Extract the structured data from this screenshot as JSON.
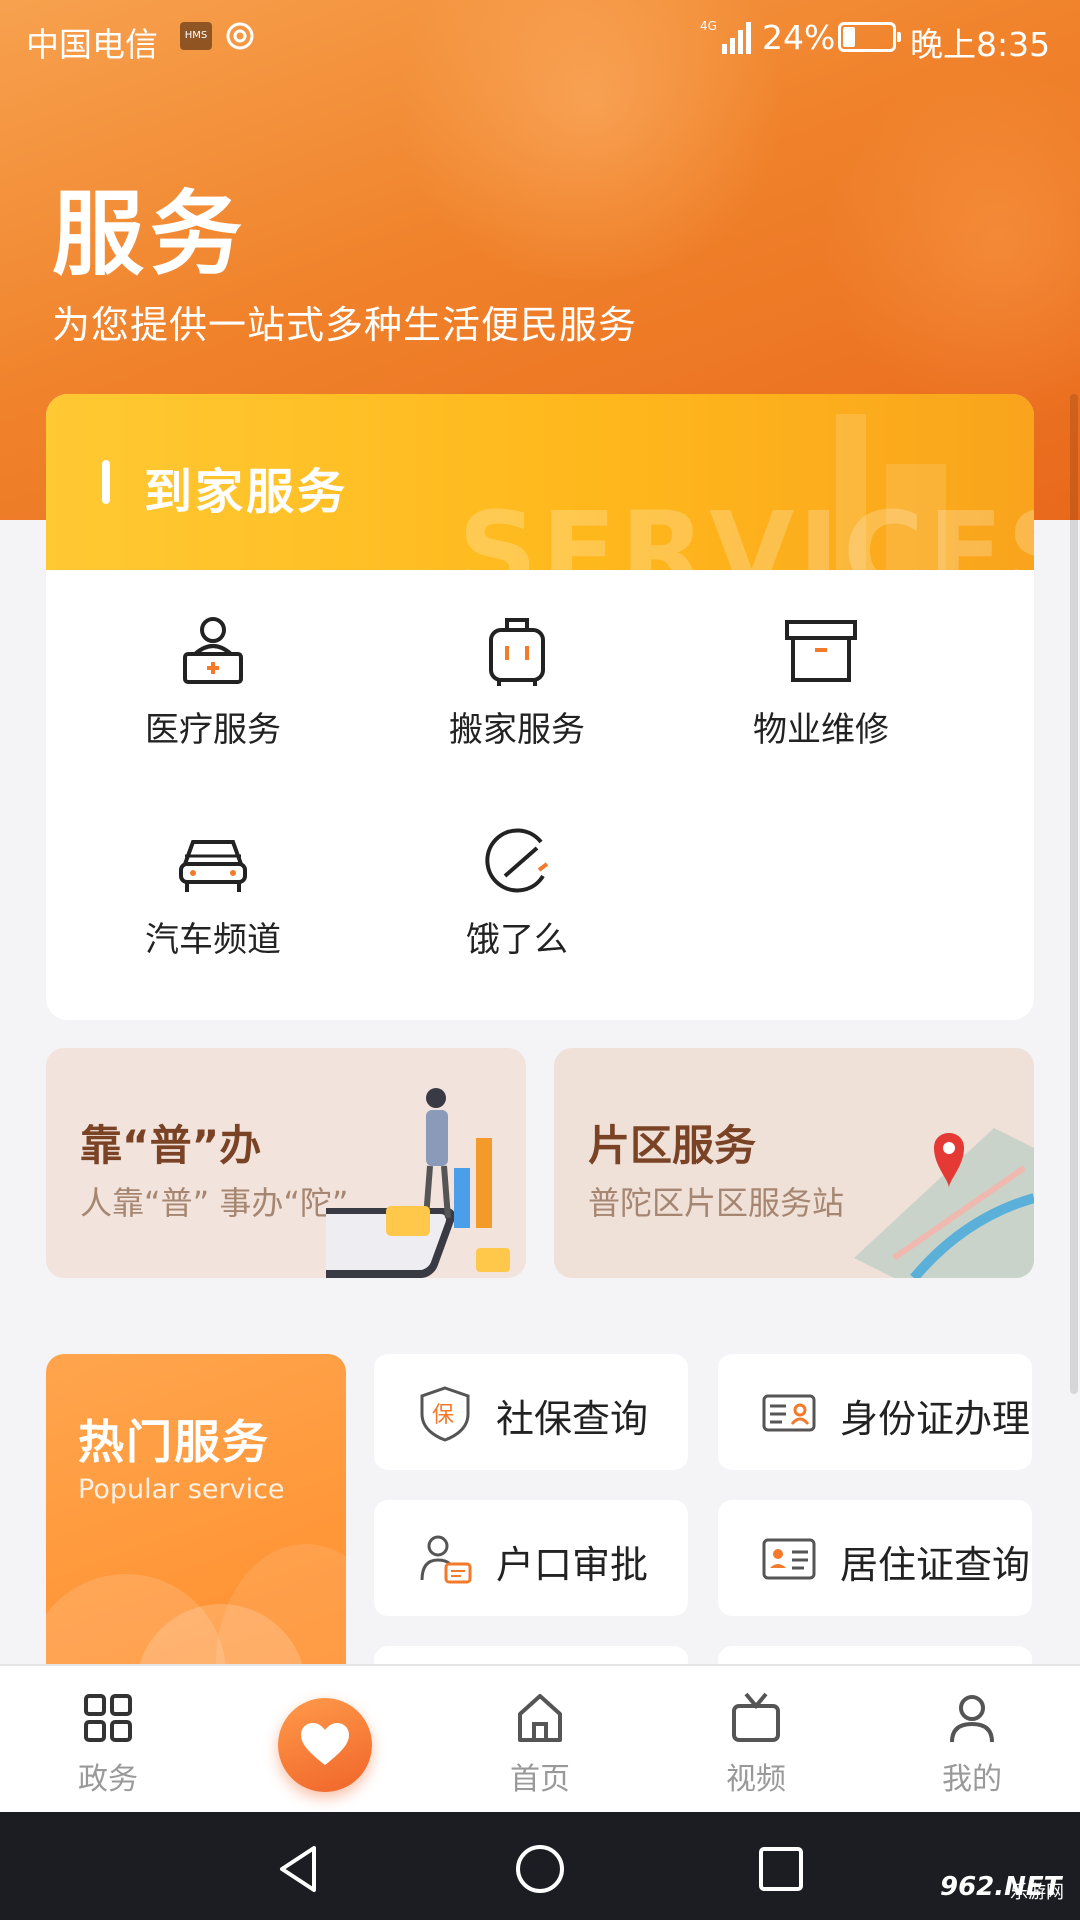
{
  "status_bar": {
    "carrier": "中国电信",
    "hms": "HMS",
    "battery": "24%",
    "time": "晚上8:35"
  },
  "header": {
    "title": "服务",
    "subtitle": "为您提供一站式多种生活便民服务"
  },
  "home_services": {
    "title": "到家服务",
    "bg_word": "SERVICES",
    "items": [
      {
        "label": "医疗服务",
        "icon": "doctor-icon"
      },
      {
        "label": "搬家服务",
        "icon": "luggage-icon"
      },
      {
        "label": "物业维修",
        "icon": "box-icon"
      },
      {
        "label": "汽车频道",
        "icon": "car-icon"
      },
      {
        "label": "饿了么",
        "icon": "eleme-icon"
      }
    ]
  },
  "banners": [
    {
      "title": "靠“普”办",
      "subtitle": "人靠“普” 事办“陀”"
    },
    {
      "title": "片区服务",
      "subtitle": "普陀区片区服务站"
    }
  ],
  "popular": {
    "title": "热门服务",
    "subtitle": "Popular service",
    "tiles": [
      {
        "label": "社保查询",
        "icon": "social-security-icon"
      },
      {
        "label": "身份证办理",
        "icon": "id-card-icon"
      },
      {
        "label": "户口审批",
        "icon": "household-icon"
      },
      {
        "label": "居住证查询",
        "icon": "residence-card-icon"
      }
    ]
  },
  "bottom_nav": {
    "items": [
      {
        "label": "政务",
        "icon": "grid-icon"
      },
      {
        "label": "首页",
        "icon": "home-icon"
      },
      {
        "label": "视频",
        "icon": "tv-icon"
      },
      {
        "label": "我的",
        "icon": "user-icon"
      }
    ],
    "center_icon": "heart-icon"
  },
  "watermark": {
    "text": "962.NET",
    "sub": "乐游网"
  },
  "colors": {
    "accent": "#f0822b",
    "card_header": "#ffb81c",
    "icon_accent": "#f27a2a",
    "nav_text": "#999999"
  }
}
